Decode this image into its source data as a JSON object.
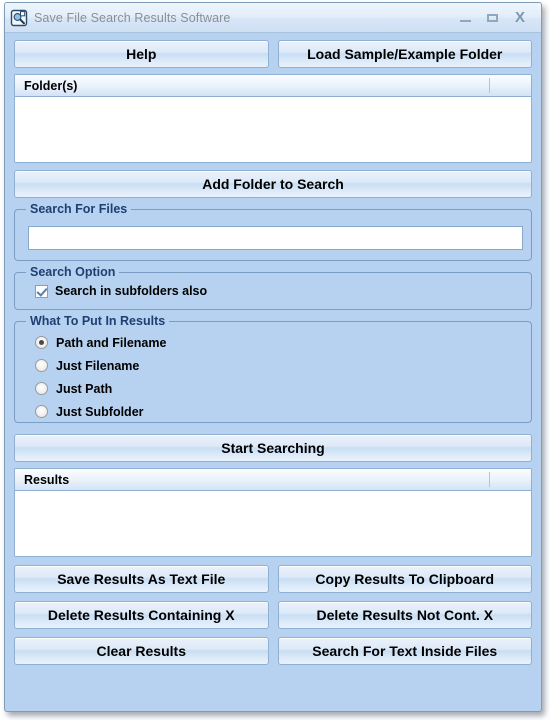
{
  "window": {
    "title": "Save File Search Results Software",
    "icon": "app-icon",
    "controls": {
      "minimize": "minimize-icon",
      "maximize": "maximize-icon",
      "close": "X"
    }
  },
  "toolbar": {
    "help_label": "Help",
    "load_sample_label": "Load Sample/Example Folder"
  },
  "folders_list": {
    "column_header": "Folder(s)",
    "rows": []
  },
  "add_folder_label": "Add Folder to Search",
  "search_for_files": {
    "group_label": "Search For Files",
    "input_value": "",
    "input_placeholder": ""
  },
  "search_option": {
    "group_label": "Search Option",
    "subfolders_label": "Search in subfolders also",
    "subfolders_checked": true
  },
  "what_to_put": {
    "group_label": "What To Put In Results",
    "options": [
      {
        "label": "Path and Filename",
        "selected": true
      },
      {
        "label": "Just Filename",
        "selected": false
      },
      {
        "label": "Just Path",
        "selected": false
      },
      {
        "label": "Just Subfolder",
        "selected": false
      }
    ]
  },
  "start_search_label": "Start Searching",
  "results_list": {
    "column_header": "Results",
    "rows": []
  },
  "bottom_buttons": [
    {
      "label": "Save Results As Text File"
    },
    {
      "label": "Copy Results To Clipboard"
    },
    {
      "label": "Delete Results Containing X"
    },
    {
      "label": "Delete Results Not Cont. X"
    },
    {
      "label": "Clear Results"
    },
    {
      "label": "Search For Text Inside Files"
    }
  ],
  "colors": {
    "window_background": "#b6d2f0",
    "group_label_text": "#1f3f70",
    "title_text": "#8a8f96",
    "button_border": "#8fb0d0"
  }
}
